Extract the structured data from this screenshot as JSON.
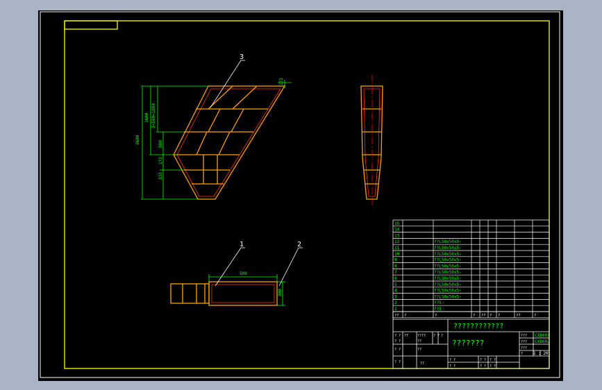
{
  "theme": {
    "frame": "#ffff00",
    "part": "#ff9f00",
    "part_inner": "#ff3300",
    "dimension": "#00ff00",
    "leader": "#ffffff",
    "centerline": "#ff0000",
    "table_line": "#ffffff",
    "table_text": "#00ff00"
  },
  "balloons": {
    "b1": "1",
    "b2": "2",
    "b3": "3"
  },
  "dims": {
    "overall_height": "2600",
    "upper_height": "1600",
    "pitch": "3×580=1600",
    "mid_height": "580",
    "lower1": "173",
    "lower2": "333",
    "top_small": "173",
    "width_500": "500",
    "height_300": "300"
  },
  "bom": {
    "row_numbers": [
      "15",
      "14",
      "13",
      "12",
      "11",
      "10",
      "9",
      "8",
      "7",
      "6",
      "5",
      "4",
      "3",
      "2",
      "1"
    ],
    "spec_rows": [
      {
        "row": "12",
        "text": "??L50x50x5-"
      },
      {
        "row": "11",
        "text": "??L50x50x5-"
      },
      {
        "row": "10",
        "text": "??L50x50x5-"
      },
      {
        "row": "9",
        "text": "??L50x50x5-"
      },
      {
        "row": "8",
        "text": "??L50x50x5-"
      },
      {
        "row": "7",
        "text": "??L50x50x5-"
      },
      {
        "row": "6",
        "text": "??L50x50x5-"
      },
      {
        "row": "5",
        "text": "??L50x50x5-"
      },
      {
        "row": "4",
        "text": "??L50x50x5-"
      },
      {
        "row": "3",
        "text": "??L50x50x5-"
      },
      {
        "row": "2",
        "text": "??5-"
      },
      {
        "row": "1",
        "text": "??5-"
      }
    ],
    "header": [
      "??",
      "?",
      "?",
      "?",
      "??",
      "?",
      "?",
      "??",
      "?"
    ]
  },
  "title_block": {
    "company": "????????????",
    "drawing_name": "???????",
    "code1": "CXB001",
    "code2": "CXB002",
    "scale": "1 : 20",
    "left_rows": [
      [
        "? ?",
        "??",
        "????",
        "? ?",
        "?"
      ],
      [
        "? ?",
        "??",
        "",
        ""
      ],
      [
        "? ?",
        "??",
        "",
        ""
      ]
    ],
    "right_labels": [
      "???",
      "???",
      "???",
      "?"
    ],
    "bottom_cells": [
      "? ?",
      "? ?",
      "? ?",
      "? ?",
      "? ?",
      "? ?"
    ]
  }
}
